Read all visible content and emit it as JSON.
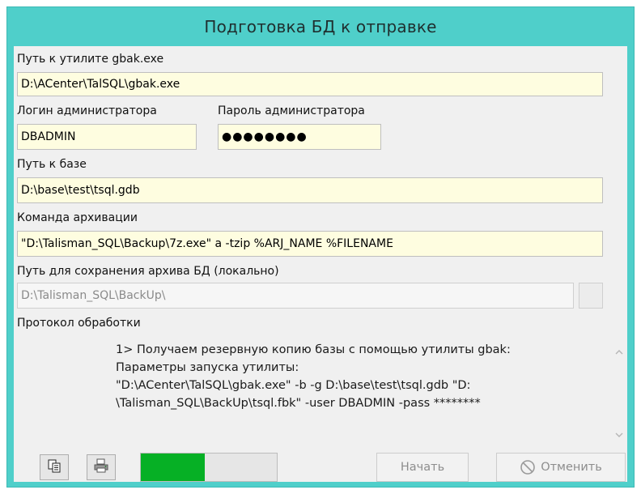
{
  "window": {
    "title": "Подготовка БД к отправке"
  },
  "form": {
    "gbak_path": {
      "label": "Путь к утилите gbak.exe",
      "value": "D:\\ACenter\\TalSQL\\gbak.exe"
    },
    "admin_login": {
      "label": "Логин администратора",
      "value": "DBADMIN"
    },
    "admin_password": {
      "label": "Пароль администратора",
      "value": "●●●●●●●●"
    },
    "db_path": {
      "label": "Путь к базе",
      "value": "D:\\base\\test\\tsql.gdb"
    },
    "archive_command": {
      "label": "Команда архивации",
      "value": "\"D:\\Talisman_SQL\\Backup\\7z.exe\" a -tzip %ARJ_NAME %FILENAME"
    },
    "archive_save_path": {
      "label": "Путь для сохранения архива БД (локально)",
      "value": "D:\\Talisman_SQL\\BackUp\\"
    }
  },
  "log": {
    "label": "Протокол обработки",
    "lines": [
      "1> Получаем резервную копию базы с помощью утилиты gbak:",
      "Параметры запуска утилиты:",
      "\"D:\\ACenter\\TalSQL\\gbak.exe\" -b -g D:\\base\\test\\tsql.gdb \"D:",
      "\\Talisman_SQL\\BackUp\\tsql.fbk\" -user DBADMIN -pass ********"
    ]
  },
  "toolbar": {
    "copy_icon": "copy-icon",
    "print_icon": "printer-icon",
    "progress": 0.47,
    "progress_color": "#06b025",
    "start_label": "Начать",
    "cancel_label": "Отменить",
    "cancel_icon": "cancel-icon"
  },
  "colors": {
    "title_bar": "#4fcfca",
    "field_bg": "#fefde0",
    "client_bg": "#f0f0f0"
  }
}
